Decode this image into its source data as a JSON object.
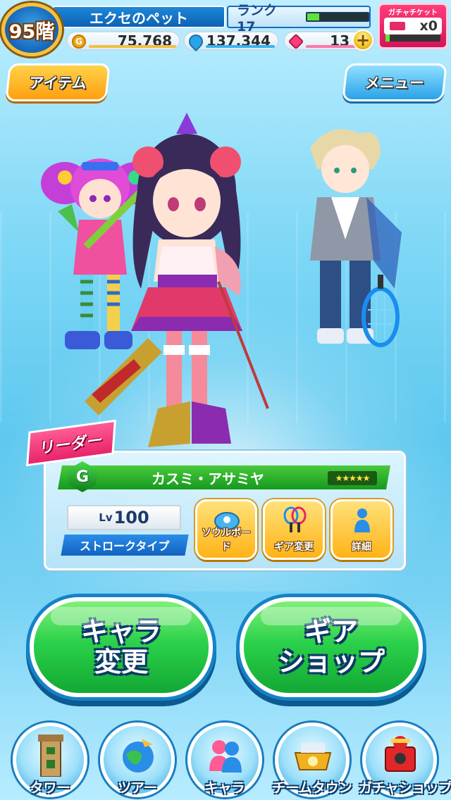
{
  "hud": {
    "floor": "95階",
    "player_name": "エクセのペット",
    "rank_label": "ランク17",
    "rank_progress": 0.2,
    "gold": "75,768",
    "soul": "137,344",
    "gems": "13",
    "plus": "+",
    "gacha_ticket_label": "ガチャチケット",
    "gacha_ticket_count": "x0"
  },
  "top_buttons": {
    "item": "アイテム",
    "menu": "メニュー"
  },
  "leader_label": "リーダー",
  "character": {
    "grade": "G",
    "name": "カスミ・アサミヤ",
    "stars": "★★★★★",
    "lv_prefix": "Lv",
    "level": "100",
    "type": "ストロークタイプ"
  },
  "actions": {
    "soul_board": "ソウルボード",
    "gear_change": "ギア変更",
    "detail": "詳細"
  },
  "big_buttons": {
    "chara_change_line1": "キャラ",
    "chara_change_line2": "変更",
    "gear_shop_line1": "ギア",
    "gear_shop_line2": "ショップ"
  },
  "nav": {
    "tower": "タワー",
    "tour": "ツアー",
    "chara": "キャラ",
    "team_town": "チームタウン",
    "gacha_shop": "ガチャショップ"
  },
  "colors": {
    "accent_green": "#2bd14a",
    "accent_blue": "#1a6cc0",
    "accent_pink": "#e8246a",
    "accent_gold": "#ffb316"
  }
}
